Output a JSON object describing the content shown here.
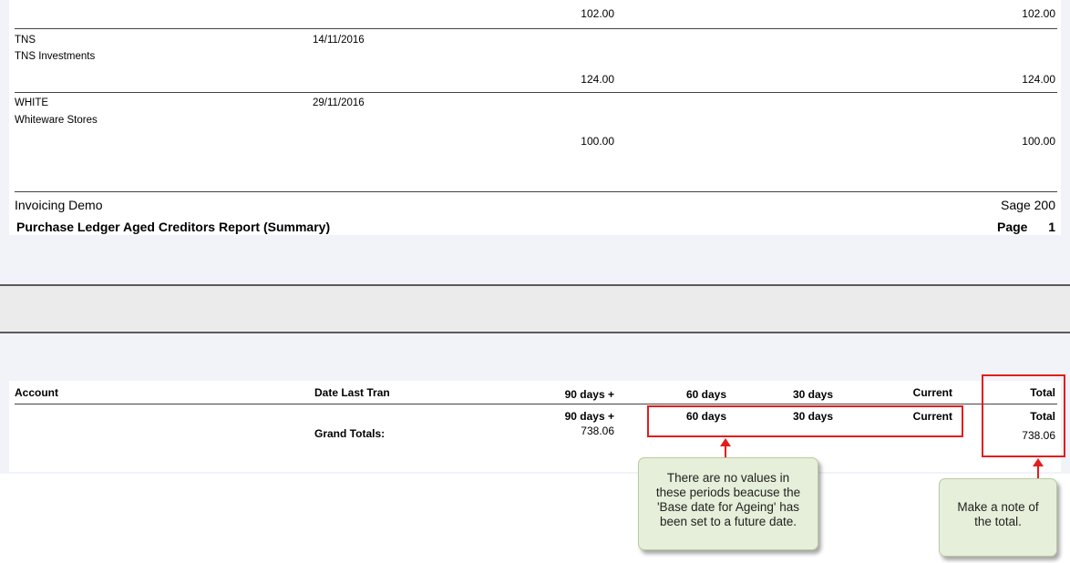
{
  "top_section": {
    "first_row": {
      "col_90": "102.00",
      "total": "102.00"
    },
    "suppliers": [
      {
        "code": "TNS",
        "name": "TNS Investments",
        "date": "14/11/2016",
        "col_90": "124.00",
        "total": "124.00"
      },
      {
        "code": "WHITE",
        "name": "Whiteware Stores",
        "date": "29/11/2016",
        "col_90": "100.00",
        "total": "100.00"
      }
    ],
    "footer": {
      "company": "Invoicing Demo",
      "product": "Sage 200",
      "report_title": "Purchase Ledger Aged Creditors Report (Summary)",
      "page_label": "Page",
      "page_number": "1"
    }
  },
  "bottom_section": {
    "headers": {
      "account": "Account",
      "date_last_tran": "Date Last Tran",
      "days_90": "90 days +",
      "days_60": "60 days",
      "days_30": "30 days",
      "current": "Current",
      "total": "Total"
    },
    "sub_headers": {
      "days_90": "90 days +",
      "days_60": "60 days",
      "days_30": "30 days",
      "current": "Current",
      "total": "Total"
    },
    "grand_totals": {
      "label": "Grand Totals:",
      "days_90": "738.06",
      "total": "738.06"
    }
  },
  "callouts": {
    "periods_note_lines": [
      "There are no values in",
      "these periods beacuse the",
      "'Base date for Ageing' has",
      "been set to a future date."
    ],
    "total_note_lines": [
      "Make a note of",
      "the total."
    ]
  },
  "colors": {
    "highlight": "#e31c1c",
    "callout_bg": "#e6efd9",
    "panel_bg": "#f1f3f9"
  }
}
